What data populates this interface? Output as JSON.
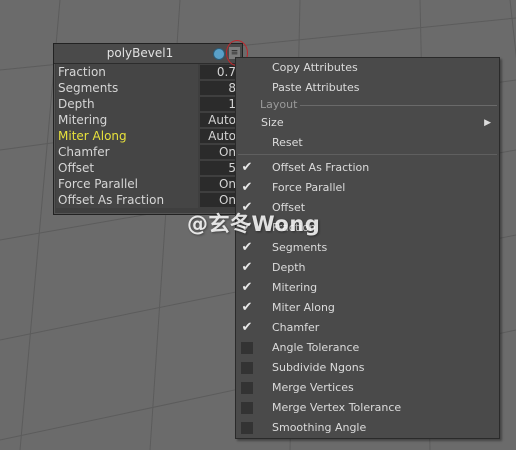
{
  "node": {
    "title": "polyBevel1",
    "attributes": [
      {
        "label": "Fraction",
        "value": "0.7",
        "highlighted": false
      },
      {
        "label": "Segments",
        "value": "8",
        "highlighted": false
      },
      {
        "label": "Depth",
        "value": "1",
        "highlighted": false
      },
      {
        "label": "Mitering",
        "value": "Auto",
        "highlighted": false
      },
      {
        "label": "Miter Along",
        "value": "Auto",
        "highlighted": true
      },
      {
        "label": "Chamfer",
        "value": "On",
        "highlighted": false
      },
      {
        "label": "Offset",
        "value": "5",
        "highlighted": false
      },
      {
        "label": "Force Parallel",
        "value": "On",
        "highlighted": false
      },
      {
        "label": "Offset As Fraction",
        "value": "On",
        "highlighted": false
      }
    ]
  },
  "menu": {
    "copy_attributes": "Copy Attributes",
    "paste_attributes": "Paste Attributes",
    "layout_section": "Layout",
    "size": "Size",
    "reset": "Reset",
    "items": [
      {
        "label": "Offset As Fraction",
        "checked": true
      },
      {
        "label": "Force Parallel",
        "checked": true
      },
      {
        "label": "Offset",
        "checked": true
      },
      {
        "label": "Fraction",
        "checked": true
      },
      {
        "label": "Segments",
        "checked": true
      },
      {
        "label": "Depth",
        "checked": true
      },
      {
        "label": "Mitering",
        "checked": true
      },
      {
        "label": "Miter Along",
        "checked": true
      },
      {
        "label": "Chamfer",
        "checked": true
      },
      {
        "label": "Angle Tolerance",
        "checked": false
      },
      {
        "label": "Subdivide Ngons",
        "checked": false
      },
      {
        "label": "Merge Vertices",
        "checked": false
      },
      {
        "label": "Merge Vertex Tolerance",
        "checked": false
      },
      {
        "label": "Smoothing Angle",
        "checked": false
      }
    ]
  },
  "watermark": "@玄冬Wong",
  "colors": {
    "viewport": "#6b6b6b",
    "highlight_label": "#e7e13b",
    "menu_bg": "#4a4a4a",
    "menu_button_ring": "#c0262c"
  },
  "icons": {
    "globe": "globe-icon",
    "menu": "menu-icon",
    "submenu": "chevron-right-icon",
    "check": "check-icon"
  }
}
